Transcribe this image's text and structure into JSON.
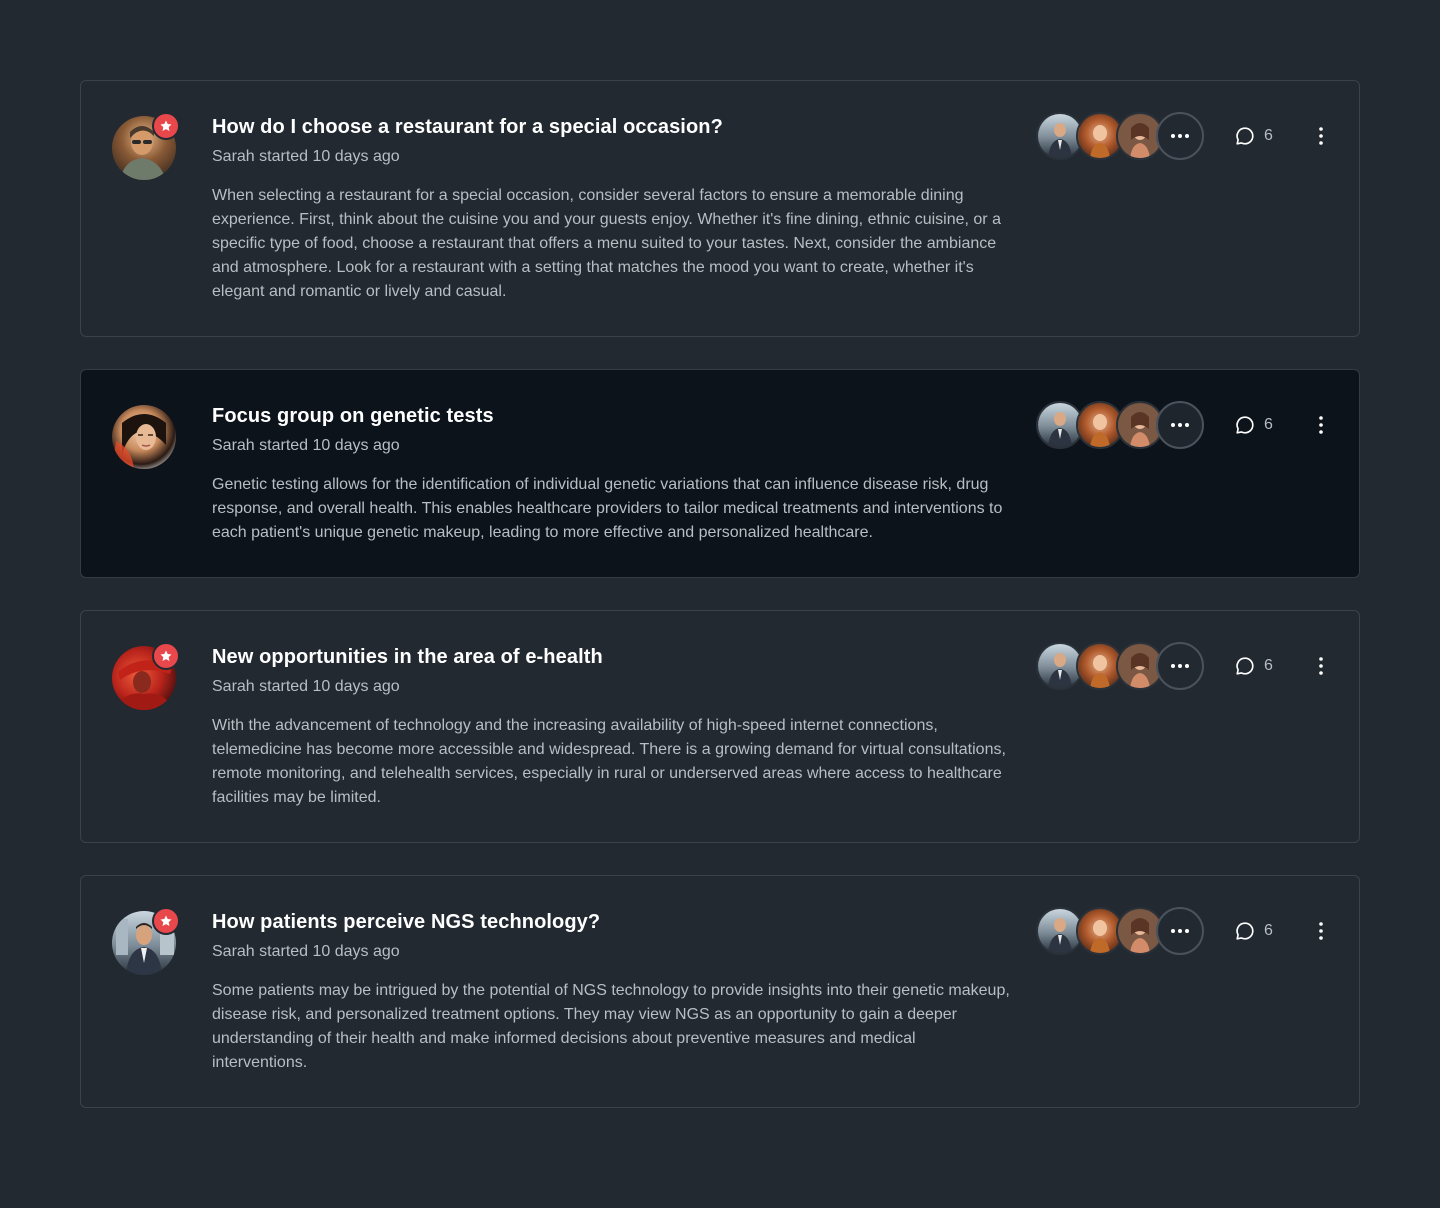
{
  "comment_icon": "speech-bubble-icon",
  "more_icon": "ellipsis-horizontal-icon",
  "kebab_icon": "vertical-dots-icon",
  "badge_icon": "star-icon",
  "badge_color": "#e8484b",
  "posts": [
    {
      "title": "How do I choose a restaurant for a special occasion?",
      "meta": "Sarah started 10 days ago",
      "body": "When selecting a restaurant for a special occasion, consider several factors to ensure a memorable dining experience. First, think about the cuisine you and your guests enjoy. Whether it's fine dining, ethnic cuisine, or a specific type of food, choose a restaurant that offers a menu suited to your tastes. Next, consider the ambiance and atmosphere. Look for a restaurant with a setting that matches the mood you want to create, whether it's elegant and romantic or lively and casual.",
      "comment_count": "6",
      "starred": true
    },
    {
      "title": "Focus group on genetic tests",
      "meta": "Sarah started 10 days ago",
      "body": "Genetic testing allows for the identification of individual genetic variations that can influence disease risk, drug response, and overall health. This enables healthcare providers to tailor medical treatments and interventions to each patient's unique genetic makeup, leading to more effective and personalized healthcare.",
      "comment_count": "6",
      "starred": false
    },
    {
      "title": "New opportunities in the area of e-health",
      "meta": "Sarah started 10 days ago",
      "body": "With the advancement of technology and the increasing availability of high-speed internet connections, telemedicine has become more accessible and widespread. There is a growing demand for virtual consultations, remote monitoring, and telehealth services, especially in rural or underserved areas where access to healthcare facilities may be limited.",
      "comment_count": "6",
      "starred": true
    },
    {
      "title": "How patients perceive NGS technology?",
      "meta": "Sarah started 10 days ago",
      "body": "Some patients may be intrigued by the potential of NGS technology to provide insights into their genetic makeup, disease risk, and personalized treatment options. They may view NGS as an opportunity to gain a deeper understanding of their health and make informed decisions about preventive measures and medical interventions.",
      "comment_count": "6",
      "starred": true
    }
  ]
}
